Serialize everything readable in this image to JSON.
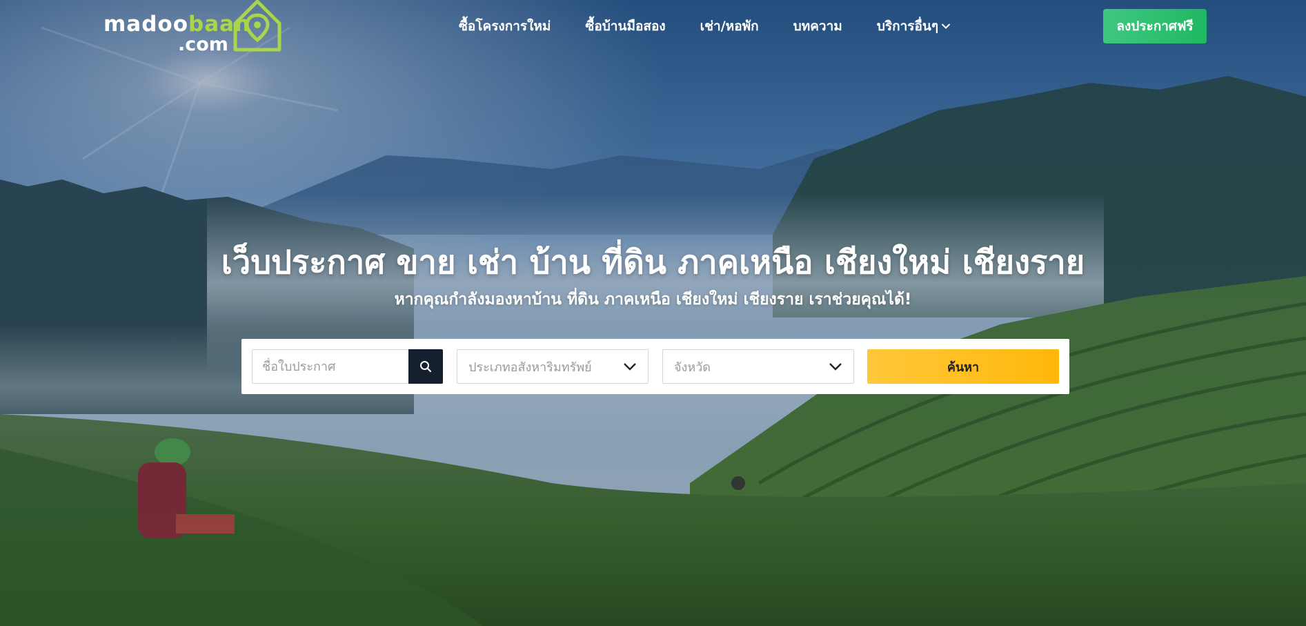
{
  "brand": {
    "logo_line1_a": "madoo",
    "logo_line1_b": "baan",
    "logo_line2": ".com",
    "accent": "#a8d44e"
  },
  "nav": {
    "items": [
      {
        "label": "ซื้อโครงการใหม่"
      },
      {
        "label": "ซื้อบ้านมือสอง"
      },
      {
        "label": "เช่า/หอพัก"
      },
      {
        "label": "บทความ"
      },
      {
        "label": "บริการอื่นๆ",
        "icon": "chevron-down-icon"
      }
    ],
    "cta_label": "ลงประกาศฟรี",
    "cta_color": "#1fb862"
  },
  "hero": {
    "title": "เว็บประกาศ ขาย เช่า บ้าน ที่ดิน ภาคเหนือ เชียงใหม่ เชียงราย",
    "subtitle": "หากคุณกำลังมองหาบ้าน ที่ดิน ภาคเหนือ เชียงใหม่ เชียงราย เราช่วยคุณได้!"
  },
  "search": {
    "name_placeholder": "ชื่อใบประกาศ",
    "search_icon": "search-icon",
    "type_placeholder": "ประเภทอสังหาริมทรัพย์",
    "province_placeholder": "จังหวัด",
    "submit_label": "ค้นหา",
    "submit_color": "#ffb70a"
  }
}
